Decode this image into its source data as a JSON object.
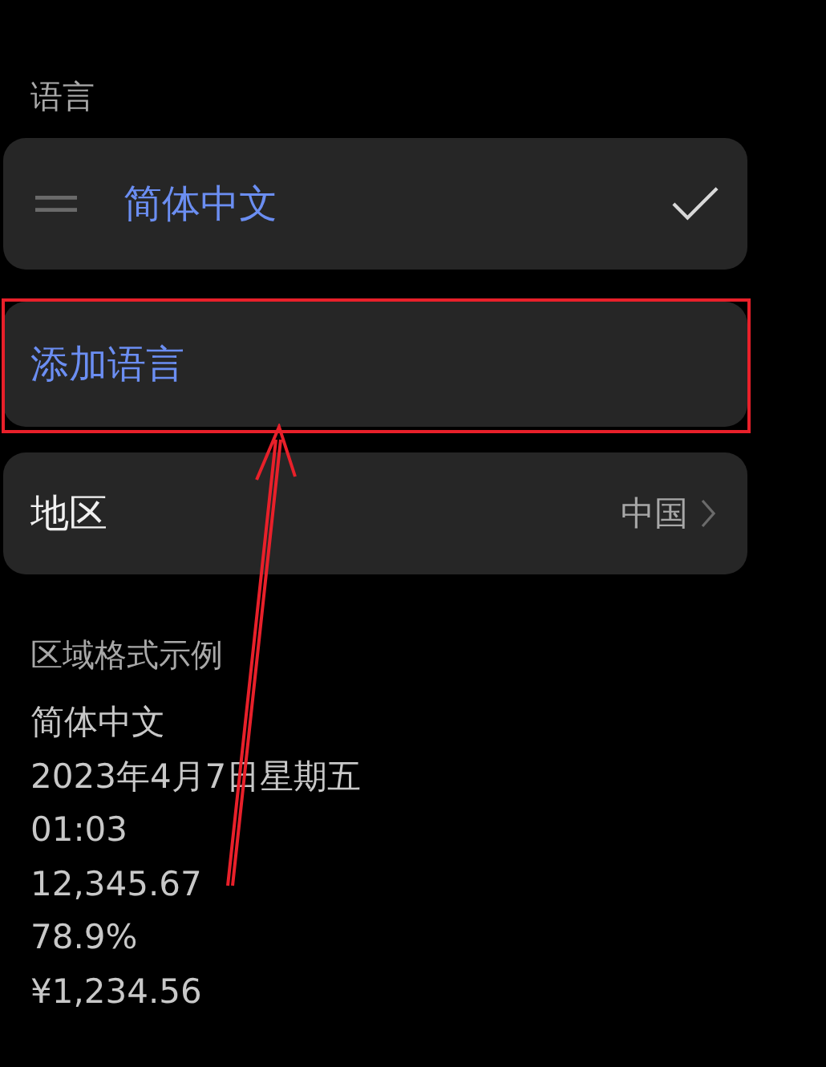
{
  "language_section": {
    "title": "语言",
    "languages": [
      {
        "name": "简体中文",
        "selected": true
      }
    ],
    "add_button": "添加语言"
  },
  "region": {
    "label": "地区",
    "value": "中国"
  },
  "format_example": {
    "title": "区域格式示例",
    "lines": [
      "简体中文",
      "2023年4月7日星期五",
      "01:03",
      "12,345.67",
      "78.9%",
      "¥1,234.56"
    ]
  }
}
